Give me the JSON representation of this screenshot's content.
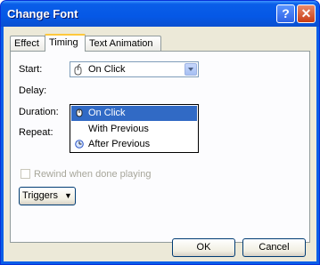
{
  "window": {
    "title": "Change Font",
    "help_label": "?",
    "close_label": "✕"
  },
  "tabs": [
    {
      "label": "Effect"
    },
    {
      "label": "Timing"
    },
    {
      "label": "Text Animation"
    }
  ],
  "form": {
    "start_label": "Start:",
    "start_value": "On Click",
    "delay_label": "Delay:",
    "duration_label": "Duration:",
    "repeat_label": "Repeat:",
    "rewind_label": "Rewind when done playing",
    "triggers_label": "Triggers"
  },
  "dropdown_options": [
    {
      "label": "On Click",
      "icon": "mouse-icon",
      "selected": true
    },
    {
      "label": "With Previous",
      "icon": "",
      "selected": false
    },
    {
      "label": "After Previous",
      "icon": "clock-icon",
      "selected": false
    }
  ],
  "buttons": {
    "ok": "OK",
    "cancel": "Cancel"
  }
}
